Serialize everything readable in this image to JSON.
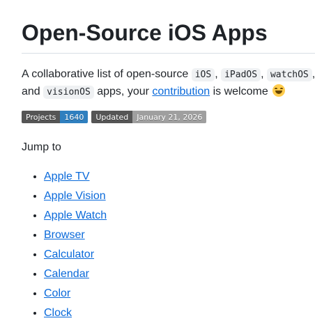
{
  "title": "Open-Source iOS Apps",
  "intro": {
    "text1": "A collaborative list of open-source",
    "code1": "iOS",
    "sep1": ",",
    "code2": "iPadOS",
    "sep2": ",",
    "code3": "watchOS",
    "sep3": ",",
    "and": "and",
    "code4": "visionOS",
    "text2": "apps, your",
    "link": "contribution",
    "text3": "is welcome",
    "emoji": "smile-emoji-icon"
  },
  "badges": [
    {
      "label": "Projects",
      "value": "1640",
      "color": "#2f7fbf"
    },
    {
      "label": "Updated",
      "value": "January 21, 2026",
      "color": "#9f9f9f"
    }
  ],
  "jump_to": "Jump to",
  "categories": [
    "Apple TV",
    "Apple Vision",
    "Apple Watch",
    "Browser",
    "Calculator",
    "Calendar",
    "Color",
    "Clock"
  ]
}
